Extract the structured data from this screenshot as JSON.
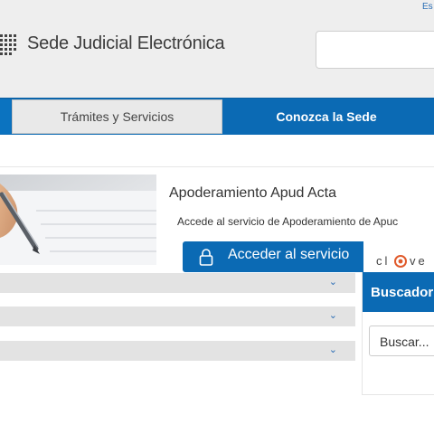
{
  "header": {
    "language_link": "Es",
    "site_title": "Sede Judicial Electrónica",
    "search": {
      "value": ""
    }
  },
  "nav": {
    "tabs": [
      {
        "label": "Trámites y Servicios"
      },
      {
        "label": "Conozca la Sede"
      }
    ]
  },
  "service": {
    "title": "Apoderamiento Apud Acta",
    "description": "Accede al servicio de Apoderamiento de Apuc",
    "access_button": "Acceder al servicio",
    "clave_logo_text": "cl@ve"
  },
  "accordion": {
    "items": [
      {
        "label": ""
      },
      {
        "label": ""
      },
      {
        "label": ""
      }
    ]
  },
  "buscador": {
    "title": "Buscador",
    "input_value": "Buscar..."
  },
  "colors": {
    "primary": "#0b6ab4",
    "header_bg": "#eeeeee",
    "accordion_bg": "#e3e3e3"
  }
}
